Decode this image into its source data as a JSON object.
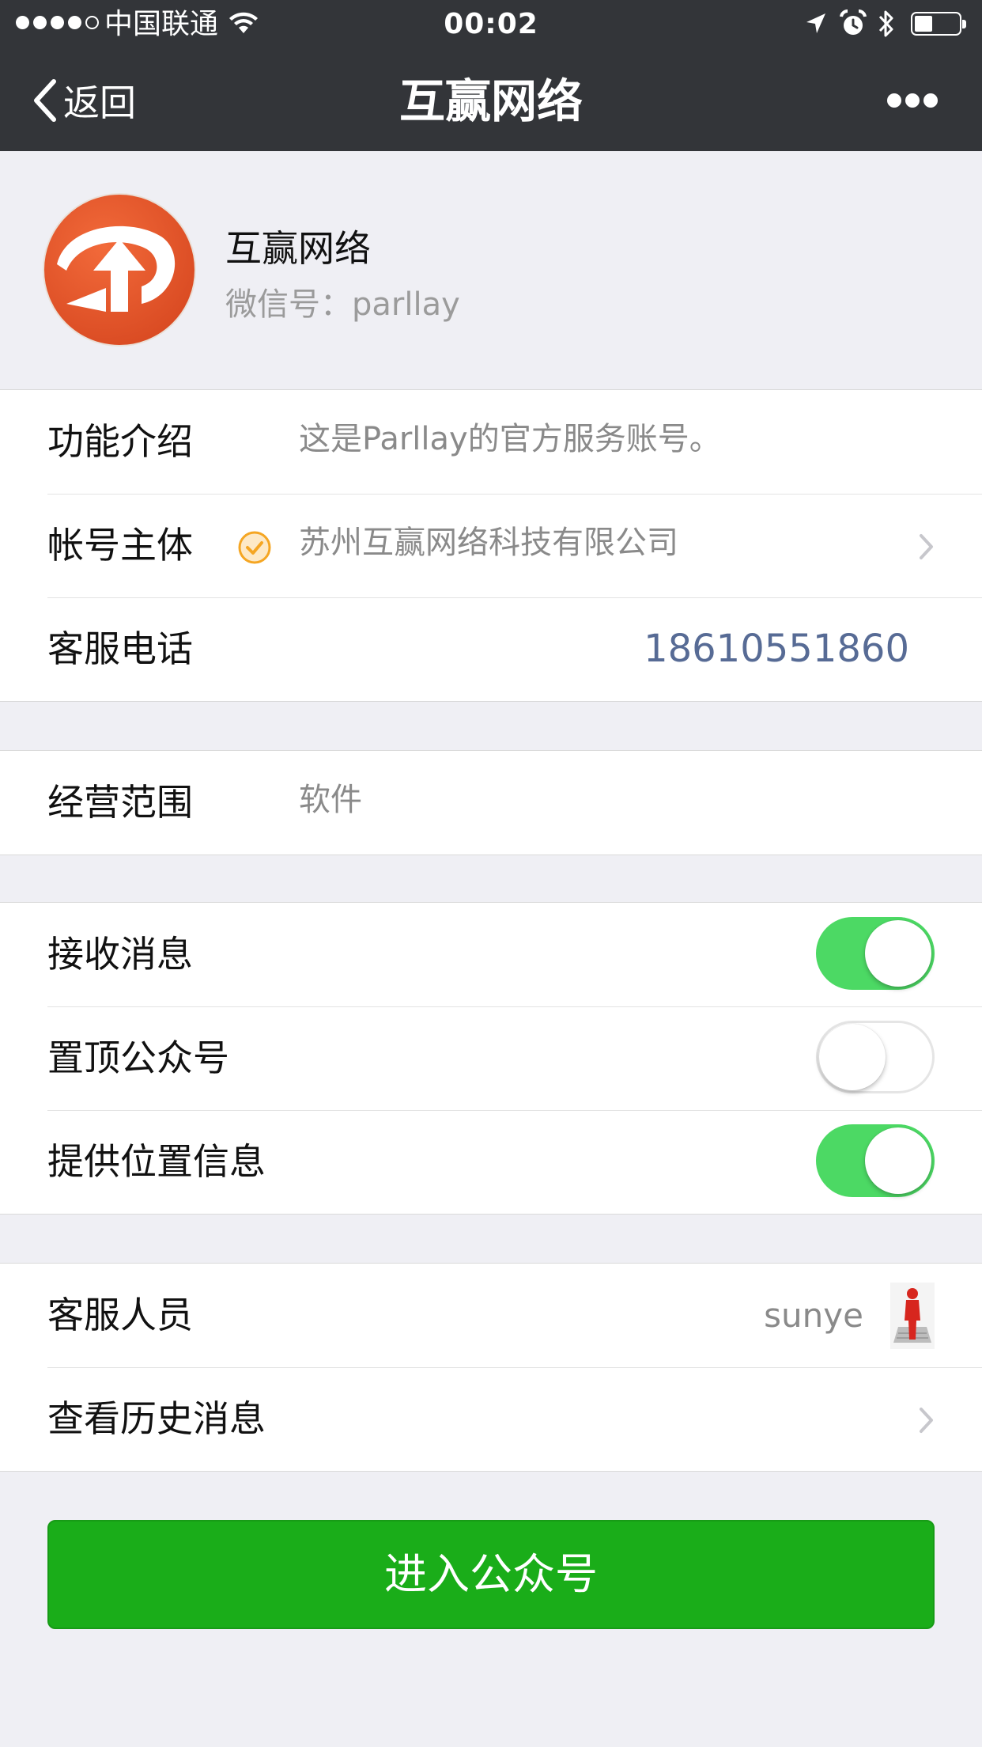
{
  "status_bar": {
    "carrier": "中国联通",
    "time": "00:02",
    "signal_bars": 4,
    "battery_level": 0.35
  },
  "nav": {
    "back_label": "返回",
    "title": "互赢网络",
    "more_icon": "more-dots-icon"
  },
  "profile": {
    "name": "互赢网络",
    "wechat_id": "微信号：parllay"
  },
  "info_group": {
    "intro_label": "功能介绍",
    "intro_value": "这是Parllay的官方服务账号。",
    "entity_label": "帐号主体",
    "entity_value": "苏州互赢网络科技有限公司",
    "phone_label": "客服电话",
    "phone_value": "18610551860"
  },
  "scope_group": {
    "scope_label": "经营范围",
    "scope_value": "软件"
  },
  "settings_group": {
    "receive_label": "接收消息",
    "receive_on": true,
    "pin_label": "置顶公众号",
    "pin_on": false,
    "location_label": "提供位置信息",
    "location_on": true
  },
  "service_group": {
    "agent_label": "客服人员",
    "agent_name": "sunye",
    "history_label": "查看历史消息"
  },
  "enter_button": "进入公众号",
  "colors": {
    "nav_bg": "#333539",
    "page_bg": "#efeff4",
    "toggle_on": "#4cd964",
    "button_green": "#1aad19",
    "phone_link": "#576b95",
    "logo_orange": "#e8552a"
  }
}
